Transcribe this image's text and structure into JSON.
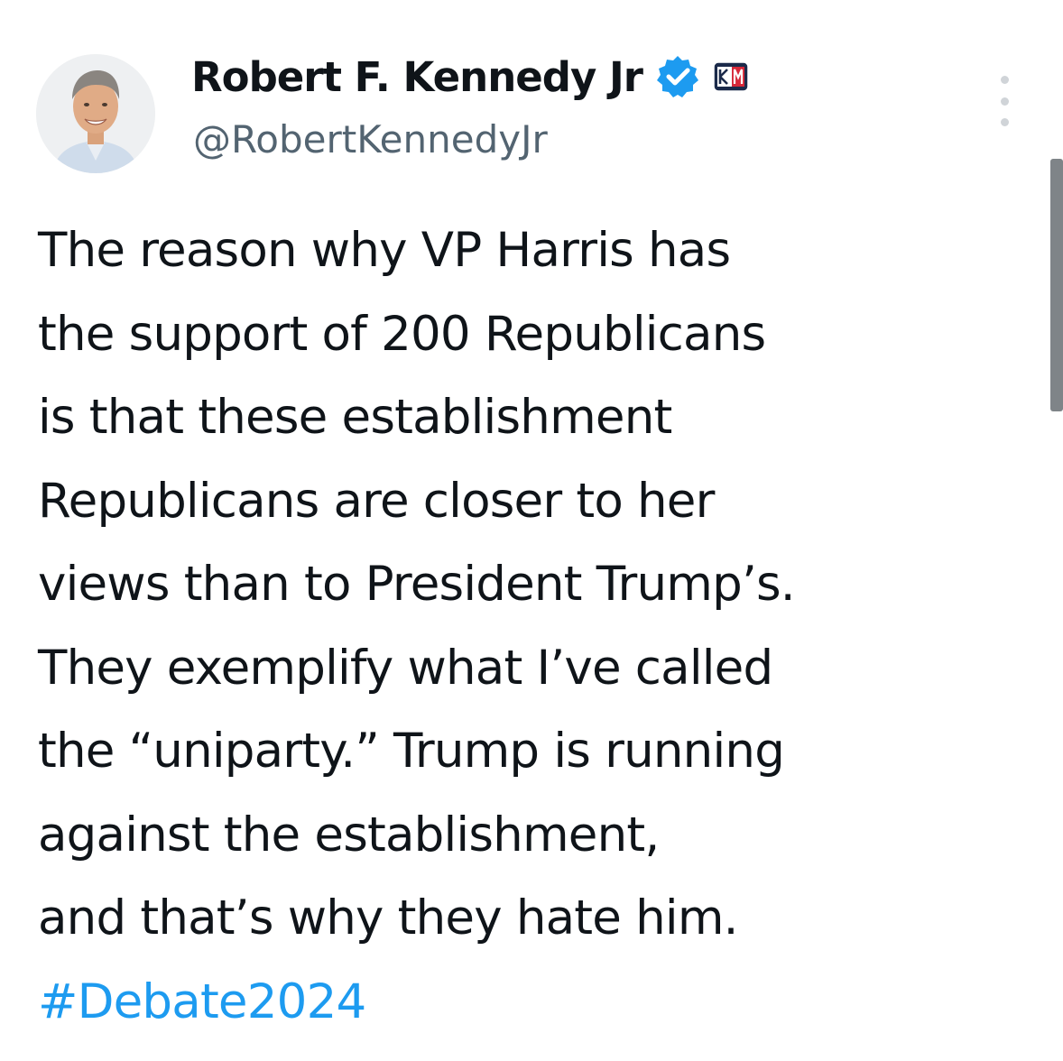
{
  "author": {
    "display_name": "Robert F. Kennedy Jr",
    "handle": "@RobertKennedyJr",
    "avatar_icon": "profile-photo",
    "verified_icon": "verified-badge-icon",
    "affiliate_badge_icon": "affiliation-badge-icon",
    "badge_text": "KM"
  },
  "menu": {
    "icon": "more-options-icon"
  },
  "tweet": {
    "lines": [
      "The reason why VP Harris has",
      "the support of 200 Republicans",
      "is that these establishment",
      "Republicans are closer to her",
      "views than to President Trump’s.",
      "They exemplify what I’ve called",
      "the “uniparty.” Trump is running",
      "against the establishment,",
      "and that’s why they hate him."
    ],
    "hashtag": "#Debate2024"
  },
  "colors": {
    "text": "#0f1419",
    "handle": "#536471",
    "link": "#1d9bf0",
    "verified": "#1d9bf0"
  }
}
